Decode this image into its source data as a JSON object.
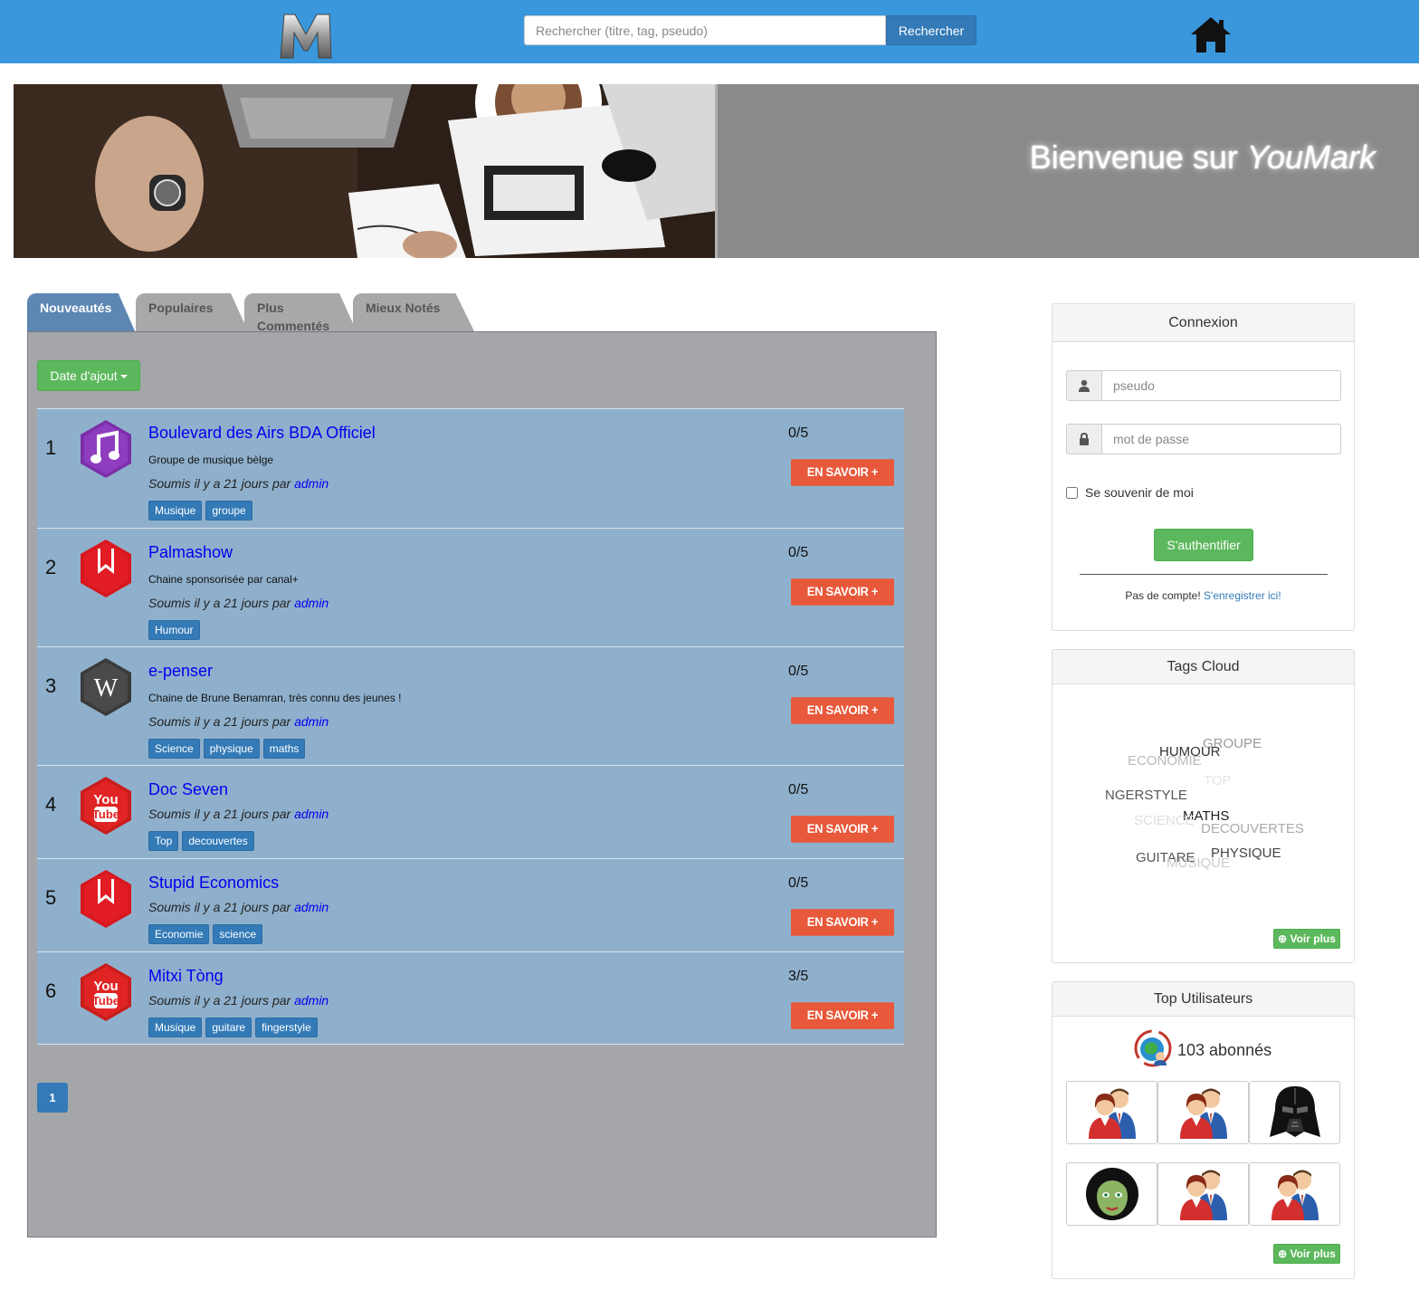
{
  "header": {
    "logo_icon": "m-logo-icon",
    "search_placeholder": "Rechercher (titre, tag, pseudo)",
    "search_button": "Rechercher",
    "home_icon": "home-icon"
  },
  "banner": {
    "title_prefix": "Bienvenue sur ",
    "title_brand": "YouMark"
  },
  "tabs": [
    {
      "label": "Nouveautés",
      "active": true
    },
    {
      "label": "Populaires",
      "active": false
    },
    {
      "label": "Plus Commentés",
      "active": false
    },
    {
      "label": "Mieux Notés",
      "active": false
    }
  ],
  "sort_button": "Date d'ajout",
  "items": [
    {
      "rank": "1",
      "icon": "music-note-icon",
      "title": "Boulevard des Airs BDA Officiel",
      "description": "Groupe de musique bèlge",
      "meta_prefix": "Soumis il y a 21 jours par ",
      "author": "admin",
      "tags": [
        "Musique",
        "groupe"
      ],
      "score": "0/5",
      "button": "EN SAVOIR +"
    },
    {
      "rank": "2",
      "icon": "bookmark-icon",
      "title": "Palmashow",
      "description": "Chaine sponsorisée par canal+",
      "meta_prefix": "Soumis il y a 21 jours par ",
      "author": "admin",
      "tags": [
        "Humour"
      ],
      "score": "0/5",
      "button": "EN SAVOIR +"
    },
    {
      "rank": "3",
      "icon": "wikipedia-icon",
      "title": "e-penser",
      "description": "Chaine de Brune Benamran, très connu des jeunes !",
      "meta_prefix": "Soumis il y a 21 jours par ",
      "author": "admin",
      "tags": [
        "Science",
        "physique",
        "maths"
      ],
      "score": "0/5",
      "button": "EN SAVOIR +"
    },
    {
      "rank": "4",
      "icon": "youtube-icon",
      "title": "Doc Seven",
      "description": "",
      "meta_prefix": "Soumis il y a 21 jours par ",
      "author": "admin",
      "tags": [
        "Top",
        "decouvertes"
      ],
      "score": "0/5",
      "button": "EN SAVOIR +"
    },
    {
      "rank": "5",
      "icon": "bookmark-icon",
      "title": "Stupid Economics",
      "description": "",
      "meta_prefix": "Soumis il y a 21 jours par ",
      "author": "admin",
      "tags": [
        "Economie",
        "science"
      ],
      "score": "0/5",
      "button": "EN SAVOIR +"
    },
    {
      "rank": "6",
      "icon": "youtube-icon",
      "title": "Mitxi Tòng",
      "description": "",
      "meta_prefix": "Soumis il y a 21 jours par ",
      "author": "admin",
      "tags": [
        "Musique",
        "guitare",
        "fingerstyle"
      ],
      "score": "3/5",
      "button": "EN SAVOIR +"
    }
  ],
  "pagination": {
    "current": "1"
  },
  "login": {
    "title": "Connexion",
    "username_placeholder": "pseudo",
    "password_placeholder": "mot de passe",
    "remember_label": "Se souvenir de moi",
    "submit": "S'authentifier",
    "no_account": "Pas de compte! ",
    "register_link": "S'enregistrer ici!"
  },
  "tags_cloud": {
    "title": "Tags Cloud",
    "words": [
      {
        "text": "GROUPE",
        "color": "#999999"
      },
      {
        "text": "HUMOUR",
        "color": "#333333"
      },
      {
        "text": "ECONOMIE",
        "color": "#bbbbbb"
      },
      {
        "text": "TOP",
        "color": "#e6e6e6"
      },
      {
        "text": "NGERSTYLE",
        "color": "#555555"
      },
      {
        "text": "MATHS",
        "color": "#222222"
      },
      {
        "text": "SCIENCE",
        "color": "#dddddd"
      },
      {
        "text": "DECOUVERTES",
        "color": "#aaaaaa"
      },
      {
        "text": "GUITARE",
        "color": "#555555"
      },
      {
        "text": "PHYSIQUE",
        "color": "#444444"
      },
      {
        "text": "MUSIQUE",
        "color": "#cccccc"
      }
    ],
    "more": "Voir plus"
  },
  "top_users": {
    "title": "Top Utilisateurs",
    "subscribers": "103 abonnés",
    "avatars": [
      "users-couple-icon",
      "users-couple-icon",
      "darth-vader-icon",
      "woman-avatar-icon",
      "users-couple-icon",
      "users-couple-icon"
    ],
    "more": "Voir plus"
  },
  "colors": {
    "navbar": "#3a97dc",
    "list_item": "#8fb0cc",
    "panel": "#a5a6aa",
    "accent_orange": "#e8583a",
    "success_green": "#5cb85c",
    "primary_blue": "#337ab7"
  }
}
